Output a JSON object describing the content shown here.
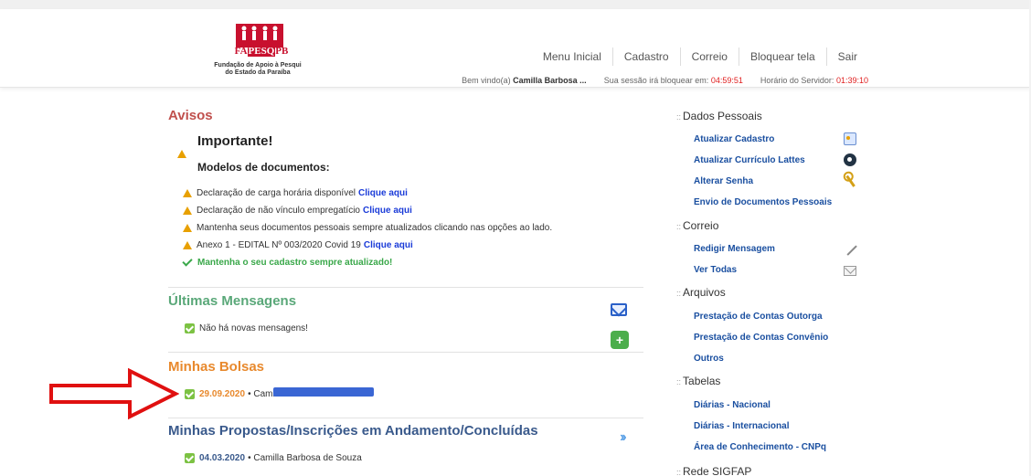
{
  "logo": {
    "brand_left": "FA",
    "brand_mid": "PESQ",
    "brand_right": "PB",
    "org_line1": "Fundação de Apoio à Pesqui",
    "org_line2": "do Estado da Paraíba"
  },
  "topnav": [
    "Menu Inicial",
    "Cadastro",
    "Correio",
    "Bloquear tela",
    "Sair"
  ],
  "session": {
    "welcome_prefix": "Bem vindo(a)",
    "user": "Camilla Barbosa ...",
    "lock_label": "Sua sessão irá bloquear em:",
    "lock_time": "04:59:51",
    "server_label": "Horário do Servidor:",
    "server_time": "01:39:10"
  },
  "avisos": {
    "title": "Avisos",
    "important_title": "Importante!",
    "important_subtitle": "Modelos de documentos:",
    "notices": [
      {
        "text": "Declaração de carga horária disponível",
        "link": "Clique aqui"
      },
      {
        "text": "Declaração de não vínculo empregatício",
        "link": "Clique aqui"
      },
      {
        "text": "Mantenha seus documentos pessoais sempre atualizados clicando nas opções ao lado.",
        "link": ""
      },
      {
        "text": "Anexo 1 - EDITAL Nº 003/2020 Covid 19",
        "link": "Clique aqui"
      }
    ],
    "keep_updated": "Mantenha o seu cadastro sempre atualizado!"
  },
  "mensagens": {
    "title": "Últimas Mensagens",
    "empty": "Não há novas mensagens!"
  },
  "bolsas": {
    "title": "Minhas Bolsas",
    "items": [
      {
        "date": "29.09.2020",
        "sep": "•",
        "name": "Camilla Barbosa de Souza"
      }
    ]
  },
  "propostas": {
    "title": "Minhas Propostas/Inscrições em Andamento/Concluídas",
    "items": [
      {
        "date": "04.03.2020",
        "sep": "•",
        "name": "Camilla Barbosa de Souza"
      }
    ]
  },
  "sidebar": {
    "sections": [
      {
        "title": "Dados Pessoais",
        "links": [
          "Atualizar Cadastro",
          "Atualizar Currículo Lattes",
          "Alterar Senha",
          "Envio de Documentos Pessoais"
        ]
      },
      {
        "title": "Correio",
        "links": [
          "Redigir Mensagem",
          "Ver Todas"
        ]
      },
      {
        "title": "Arquivos",
        "links": [
          "Prestação de Contas Outorga",
          "Prestação de Contas Convênio",
          "Outros"
        ]
      },
      {
        "title": "Tabelas",
        "links": [
          "Diárias - Nacional",
          "Diárias - Internacional",
          "Área de Conhecimento - CNPq"
        ]
      },
      {
        "title": "Rede SIGFAP",
        "links": []
      }
    ],
    "prefix": "::"
  },
  "icons": {
    "warning": "warning-icon",
    "check": "check-icon",
    "mail": "mail-icon",
    "add": "add-icon",
    "next": "double-chevron-icon",
    "card": "id-card-icon",
    "lattes": "lattes-icon",
    "key": "key-icon",
    "pen": "pen-icon",
    "envelope": "envelope-icon"
  },
  "colors": {
    "avisos": "#c0504d",
    "mensagens": "#5aa879",
    "bolsas": "#e8892d",
    "propostas": "#3a5a8c",
    "link": "#1a4fa0",
    "alert": "#e02020"
  }
}
